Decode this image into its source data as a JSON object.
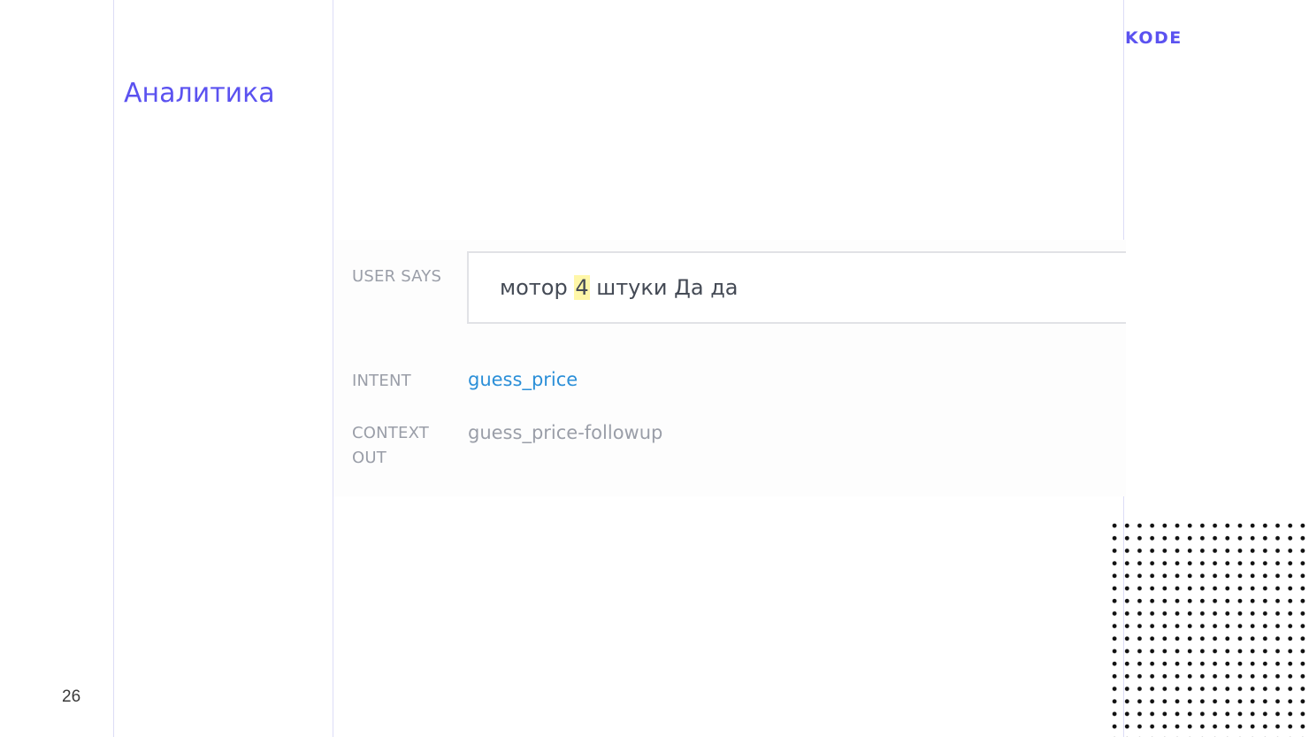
{
  "slide": {
    "logo": "KODE",
    "title": "Аналитика",
    "page_number": "26"
  },
  "dialogflow": {
    "user_says_label": "USER SAYS",
    "user_says": {
      "before": "мотор ",
      "highlight": "4",
      "after": " штуки Да да"
    },
    "intent_label": "INTENT",
    "intent_value": "guess_price",
    "context_label": "CONTEXT OUT",
    "context_value": "guess_price-followup"
  },
  "colors": {
    "brand": "#5b52f0",
    "intent_link": "#2b8fd8",
    "highlight": "#fff7a8",
    "label_gray": "#9a9ea8"
  }
}
